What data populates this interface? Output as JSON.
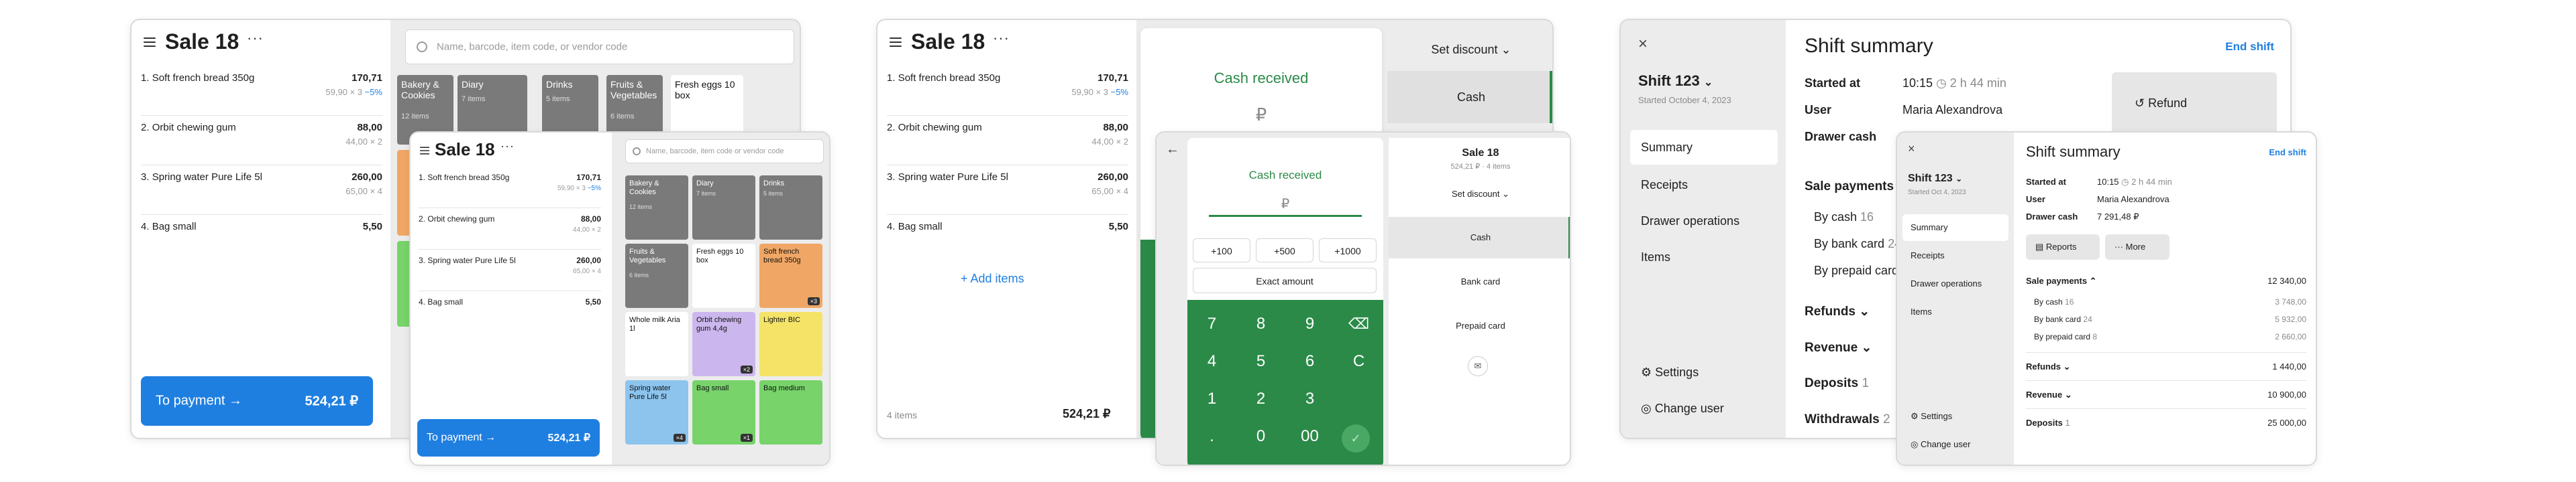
{
  "sale": {
    "title": "Sale 18",
    "total_label": "To payment",
    "total": "524,21 ₽",
    "items_count": "4 items",
    "add_items": "Add items",
    "lines": [
      {
        "index": "1.",
        "name": "Soft french bread 350g",
        "price": "170,71",
        "sub": "59,90 × 3 ",
        "disc": "−5%"
      },
      {
        "index": "2.",
        "name": "Orbit chewing gum",
        "price": "88,00",
        "sub": "44,00 × 2",
        "disc": ""
      },
      {
        "index": "3.",
        "name": "Spring water Pure Life 5l",
        "price": "260,00",
        "sub": "65,00 × 4",
        "disc": ""
      },
      {
        "index": "4.",
        "name": "Bag small",
        "price": "5,50",
        "sub": "",
        "disc": ""
      }
    ]
  },
  "catalog": {
    "search_placeholder": "Name, barcode, item code, or vendor code",
    "search_placeholder_short": "Name, barcode, item code or vendor code",
    "tiles_big": [
      {
        "name": "Bakery & Cookies",
        "sub": "12 items",
        "color": "#7a7a7a"
      },
      {
        "name": "Diary",
        "sub": "7 items",
        "color": "#7a7a7a"
      },
      {
        "name": "Drinks",
        "sub": "5 items",
        "color": "#7a7a7a"
      },
      {
        "name": "Fruits & Vegetables",
        "sub": "6 items",
        "color": "#7a7a7a"
      },
      {
        "name": "Fresh eggs 10 box",
        "sub": "",
        "color": "#ffffff"
      }
    ],
    "tiles_small": [
      {
        "name": "Bakery & Cookies",
        "sub": "12 items",
        "badge": ""
      },
      {
        "name": "Diary",
        "sub": "7 items",
        "badge": ""
      },
      {
        "name": "Drinks",
        "sub": "5 items",
        "badge": ""
      },
      {
        "name": "Fruits & Vegetables",
        "sub": "6 items",
        "badge": ""
      },
      {
        "name": "Fresh eggs 10 box",
        "sub": "",
        "badge": ""
      },
      {
        "name": "Soft french bread 350g",
        "sub": "",
        "badge": "×3"
      },
      {
        "name": "Whole milk Aria 1l",
        "sub": "",
        "badge": ""
      },
      {
        "name": "Orbit chewing gum 4,4g",
        "sub": "",
        "badge": "×2"
      },
      {
        "name": "Lighter BIC",
        "sub": "",
        "badge": ""
      },
      {
        "name": "Spring water Pure Life 5l",
        "sub": "",
        "badge": "×4"
      },
      {
        "name": "Bag small",
        "sub": "",
        "badge": "×1"
      },
      {
        "name": "Bag medium",
        "sub": "",
        "badge": ""
      }
    ],
    "colors": {
      "gray": "#7a7a7a",
      "orange": "#f0a766",
      "green": "#77d36a",
      "purple": "#cbb7ee",
      "yellow": "#f5e368",
      "blue": "#8cc4ee"
    }
  },
  "payment": {
    "cash_received": "Cash received",
    "currency": "₽",
    "set_discount": "Set discount",
    "methods": [
      "Cash",
      "Bank card",
      "Prepaid card"
    ],
    "quick": [
      "+100",
      "+500",
      "+1000"
    ],
    "exact_amount": "Exact amount",
    "keys": [
      "7",
      "8",
      "9",
      "⌫",
      "4",
      "5",
      "6",
      "C",
      "1",
      "2",
      "3",
      "",
      ".",
      "0",
      "00",
      "✓"
    ],
    "sale_title": "Sale 18",
    "sale_sub": "524,21 ₽ · 4 items"
  },
  "shift": {
    "title": "Shift summary",
    "end_shift": "End shift",
    "shift_name": "Shift 123",
    "started_long": "Started October 4, 2023",
    "started_short": "Started Oct 4, 2023",
    "nav": [
      "Summary",
      "Receipts",
      "Drawer operations",
      "Items"
    ],
    "settings": "Settings",
    "change_user": "Change user",
    "started_at_label": "Started at",
    "started_at": "10:15",
    "duration": "2 h 44 min",
    "user_label": "User",
    "user": "Maria Alexandrova",
    "drawer_label": "Drawer cash",
    "drawer_cash": "7 291,48 ₽",
    "refund_button": "Refund",
    "reports_button": "Reports",
    "more_button": "More",
    "sale_payments": "Sale payments",
    "sale_payments_total": "12 340,00",
    "by_cash": "By cash",
    "by_cash_n": "16",
    "by_cash_v": "3 748,00",
    "by_bank": "By bank card",
    "by_bank_n": "24",
    "by_bank_v": "5 932,00",
    "by_prepaid": "By prepaid card",
    "by_prepaid_n": "8",
    "by_prepaid_v": "2 660,00",
    "refunds": "Refunds",
    "refunds_v": "1 440,00",
    "revenue": "Revenue",
    "revenue_v": "10 900,00",
    "deposits": "Deposits",
    "deposits_n": "1",
    "deposits_v": "25 000,00",
    "withdrawals": "Withdrawals",
    "withdrawals_n": "2"
  }
}
